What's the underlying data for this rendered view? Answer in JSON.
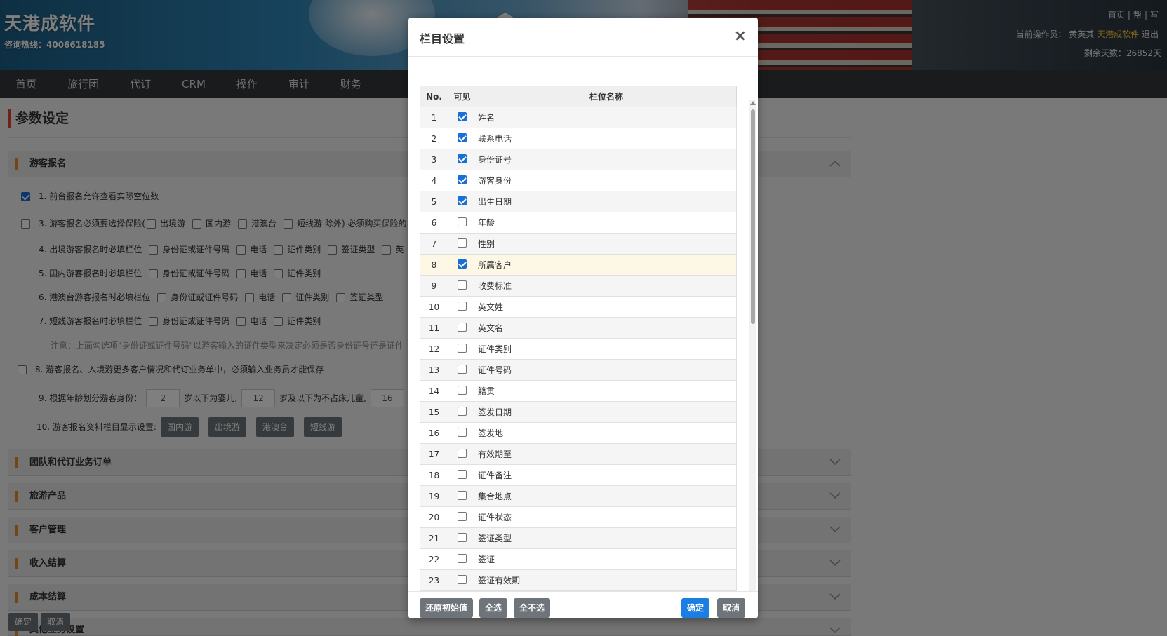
{
  "header": {
    "brand": "天港成软件",
    "hotline": "咨询热线：4006618185",
    "toplinks": [
      "首页",
      "|",
      "帮",
      "|",
      "写"
    ],
    "operator_label": "当前操作员：",
    "operator_name": "黄英其",
    "operator_company": "天港成软件",
    "logout": "退出",
    "days_left": "剩余天数：26852天"
  },
  "nav": [
    "首页",
    "旅行团",
    "代订",
    "CRM",
    "操作",
    "审计",
    "财务"
  ],
  "page": {
    "title": "参数设定",
    "sections": [
      {
        "title": "游客报名"
      },
      {
        "title": "团队和代订业务订单"
      },
      {
        "title": "旅游产品"
      },
      {
        "title": "客户管理"
      },
      {
        "title": "收入结算"
      },
      {
        "title": "成本结算"
      },
      {
        "title": "其他业务设置"
      }
    ],
    "rows": {
      "r1": "1.  前台报名允许查看实际空位数",
      "r3": "3.  游客报名必须要选择保险(",
      "r3_opts": [
        "出境游",
        "国内游",
        "港澳台",
        "短线游"
      ],
      "r3_tail": "除外) 必须购买保险的",
      "r4": "4.  出境游客报名时必填栏位",
      "r4_opts": [
        "身份证或证件号码",
        "电话",
        "证件类别",
        "签证类型",
        "英"
      ],
      "r5": "5.  国内游客报名时必填栏位",
      "r5_opts": [
        "身份证或证件号码",
        "电话",
        "证件类别"
      ],
      "r6": "6.  港澳台游客报名时必填栏位",
      "r6_opts": [
        "身份证或证件号码",
        "电话",
        "证件类别",
        "签证类型"
      ],
      "r7": "7.  短线游客报名时必填栏位",
      "r7_opts": [
        "身份证或证件号码",
        "电话",
        "证件类别"
      ],
      "note": "注意：上面勾选项\"身份证或证件号码\"以游客输入的证件类型来决定必须是否身份证号还是证件号",
      "r8": "8.  游客报名、入境游更多客户情况和代订业务单中，必须输入业务员才能保存",
      "r9_a": "9.  根据年龄划分游客身份：",
      "r9_v1": "2",
      "r9_b": "岁以下为婴儿,",
      "r9_v2": "12",
      "r9_c": "岁及以下为不占床儿童,",
      "r9_v3": "16",
      "r10": "10.  游客报名资料栏目显示设置:",
      "r10_btns": [
        "国内游",
        "出境游",
        "港澳台",
        "短线游"
      ]
    },
    "bottom_confirm": "确定",
    "bottom_cancel": "取消"
  },
  "modal": {
    "title": "栏目设置",
    "close": "×",
    "columns": {
      "no": "No.",
      "visible": "可见",
      "name": "栏位名称"
    },
    "rows": [
      {
        "no": "1",
        "name": "姓名",
        "checked": true
      },
      {
        "no": "2",
        "name": "联系电话",
        "checked": true
      },
      {
        "no": "3",
        "name": "身份证号",
        "checked": true
      },
      {
        "no": "4",
        "name": "游客身份",
        "checked": true
      },
      {
        "no": "5",
        "name": "出生日期",
        "checked": true
      },
      {
        "no": "6",
        "name": "年龄",
        "checked": false
      },
      {
        "no": "7",
        "name": "性别",
        "checked": false
      },
      {
        "no": "8",
        "name": "所属客户",
        "checked": true
      },
      {
        "no": "9",
        "name": "收费标准",
        "checked": false
      },
      {
        "no": "10",
        "name": "英文姓",
        "checked": false
      },
      {
        "no": "11",
        "name": "英文名",
        "checked": false
      },
      {
        "no": "12",
        "name": "证件类别",
        "checked": false
      },
      {
        "no": "13",
        "name": "证件号码",
        "checked": false
      },
      {
        "no": "14",
        "name": "籍贯",
        "checked": false
      },
      {
        "no": "15",
        "name": "签发日期",
        "checked": false
      },
      {
        "no": "16",
        "name": "签发地",
        "checked": false
      },
      {
        "no": "17",
        "name": "有效期至",
        "checked": false
      },
      {
        "no": "18",
        "name": "证件备注",
        "checked": false
      },
      {
        "no": "19",
        "name": "集合地点",
        "checked": false
      },
      {
        "no": "20",
        "name": "证件状态",
        "checked": false
      },
      {
        "no": "21",
        "name": "签证类型",
        "checked": false
      },
      {
        "no": "22",
        "name": "签证",
        "checked": false
      },
      {
        "no": "23",
        "name": "签证有效期",
        "checked": false
      }
    ],
    "buttons": {
      "reset": "还原初始值",
      "select_all": "全选",
      "select_none": "全不选",
      "ok": "确定",
      "cancel": "取消"
    }
  }
}
